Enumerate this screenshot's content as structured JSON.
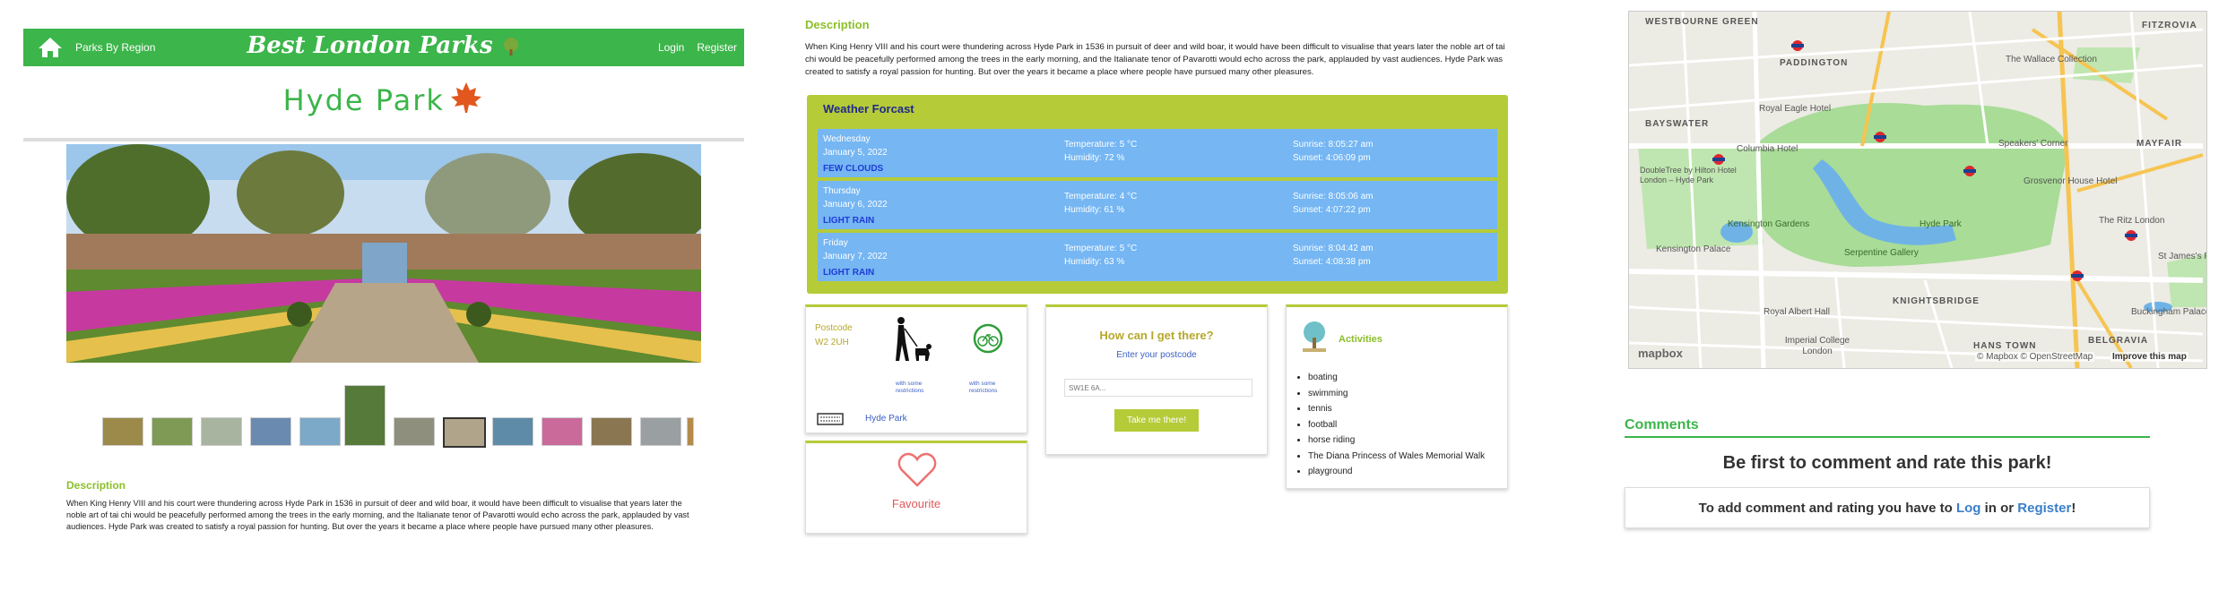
{
  "nav": {
    "regions": "Parks By Region",
    "brand": "Best London Parks",
    "login": "Login",
    "register": "Register"
  },
  "park": {
    "name": "Hyde Park"
  },
  "description": {
    "title": "Description",
    "text": "When King Henry VIII and his court were thundering across Hyde Park in 1536 in pursuit of deer and wild boar, it would have been difficult to visualise that years later the noble art of tai chi would be peacefully performed among the trees in the early morning, and the Italianate tenor of Pavarotti would echo across the park, applauded by vast audiences. Hyde Park was created to satisfy a royal passion for hunting. But over the years it became a place where people have pursued many other pleasures."
  },
  "weather": {
    "title": "Weather Forcast",
    "days": [
      {
        "day": "Wednesday",
        "date": "January 5, 2022",
        "condition": "FEW CLOUDS",
        "temperature": "Temperature: 5 °C",
        "humidity": "Humidity: 72 %",
        "sunrise": "Sunrise: 8:05:27 am",
        "sunset": "Sunset: 4:06:09 pm"
      },
      {
        "day": "Thursday",
        "date": "January 6, 2022",
        "condition": "LIGHT RAIN",
        "temperature": "Temperature: 4 °C",
        "humidity": "Humidity: 61 %",
        "sunrise": "Sunrise: 8:05:06 am",
        "sunset": "Sunset: 4:07:22 pm"
      },
      {
        "day": "Friday",
        "date": "January 7, 2022",
        "condition": "LIGHT RAIN",
        "temperature": "Temperature: 5 °C",
        "humidity": "Humidity: 63 %",
        "sunrise": "Sunrise: 8:04:42 am",
        "sunset": "Sunset: 4:08:38 pm"
      }
    ]
  },
  "info": {
    "postcode_label": "Postcode",
    "postcode": "W2 2UH",
    "dogs_note": "with some restrictions",
    "cycling_note": "with some restrictions",
    "park_link": "Hyde Park"
  },
  "directions": {
    "title": "How can I get there?",
    "subtitle": "Enter your postcode",
    "placeholder": "SW1E 6A...",
    "button": "Take me there!"
  },
  "favourite": {
    "label": "Favourite"
  },
  "activities": {
    "title": "Activities",
    "items": [
      "boating",
      "swimming",
      "tennis",
      "football",
      "horse riding",
      "The Diana Princess of Wales Memorial Walk",
      "playground"
    ]
  },
  "map": {
    "labels": [
      "WESTBOURNE GREEN",
      "FITZROVIA",
      "PADDINGTON",
      "The Wallace Collection",
      "Royal Eagle Hotel",
      "BAYSWATER",
      "Columbia Hotel",
      "MAYFAIR",
      "Speakers' Corner",
      "DoubleTree by Hilton Hotel London – Hyde Park",
      "Grosvenor House Hotel",
      "Kensington Gardens",
      "Hyde Park",
      "The Ritz London",
      "Kensington Palace",
      "Serpentine Gallery",
      "St James's Pa",
      "KNIGHTSBRIDGE",
      "Royal Albert Hall",
      "Buckingham Palace",
      "Imperial College London",
      "HANS TOWN",
      "BELGRAVIA"
    ],
    "attribution": "© Mapbox © OpenStreetMap",
    "improve": "Improve this map",
    "logo": "mapbox"
  },
  "comments": {
    "title": "Comments",
    "first": "Be first to comment and rate this park!",
    "login_prefix": "To add comment and rating you have to",
    "login": "Log",
    "login_mid": "in or",
    "register": "Register",
    "login_suffix": "!"
  }
}
